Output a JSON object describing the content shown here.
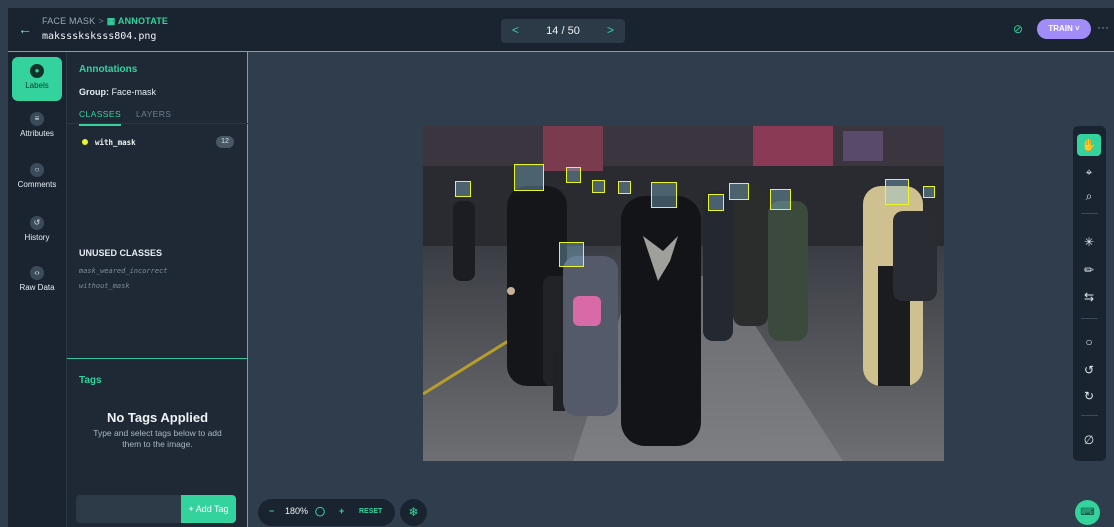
{
  "header": {
    "back_icon": "arrow-left-icon",
    "breadcrumb_project": "FACE MASK",
    "breadcrumb_sep": ">",
    "breadcrumb_section": "ANNOTATE",
    "filename": "maksssksksss804.png",
    "pager": {
      "prev": "<",
      "position": "14 / 50",
      "next": ">"
    },
    "visibility_icon": "eye-off-icon",
    "train_label": "TRAIN",
    "more_icon": "ellipsis-icon"
  },
  "rail": {
    "items": [
      {
        "label": "Labels",
        "icon": "tag-icon"
      },
      {
        "label": "Attributes",
        "icon": "list-icon"
      },
      {
        "label": "Comments",
        "icon": "comment-icon"
      },
      {
        "label": "History",
        "icon": "history-icon"
      },
      {
        "label": "Raw Data",
        "icon": "code-icon"
      }
    ]
  },
  "panel": {
    "title": "Annotations",
    "group_label": "Group:",
    "group_value": "Face-mask",
    "tabs": [
      {
        "label": "CLASSES"
      },
      {
        "label": "LAYERS"
      }
    ],
    "classes": [
      {
        "name": "with_mask",
        "count": "12",
        "color": "#e9f52a"
      }
    ],
    "unused_title": "UNUSED CLASSES",
    "unused": [
      "mask_weared_incorrect",
      "without_mask"
    ],
    "tags_title": "Tags",
    "no_tags_title": "No Tags Applied",
    "no_tags_sub": "Type and select tags below to add them to the image.",
    "tag_input_placeholder": "",
    "add_tag": "+ Add Tag"
  },
  "zoom": {
    "minus": "−",
    "value": "180%",
    "lock_icon": "unlock-icon",
    "plus": "+",
    "reset": "RESET"
  },
  "colors": {
    "accent": "#34d39e",
    "bbox": "#e9f52a",
    "train": "#a28cf7",
    "bg": "#2f3d4c",
    "panel": "#1e2935"
  }
}
